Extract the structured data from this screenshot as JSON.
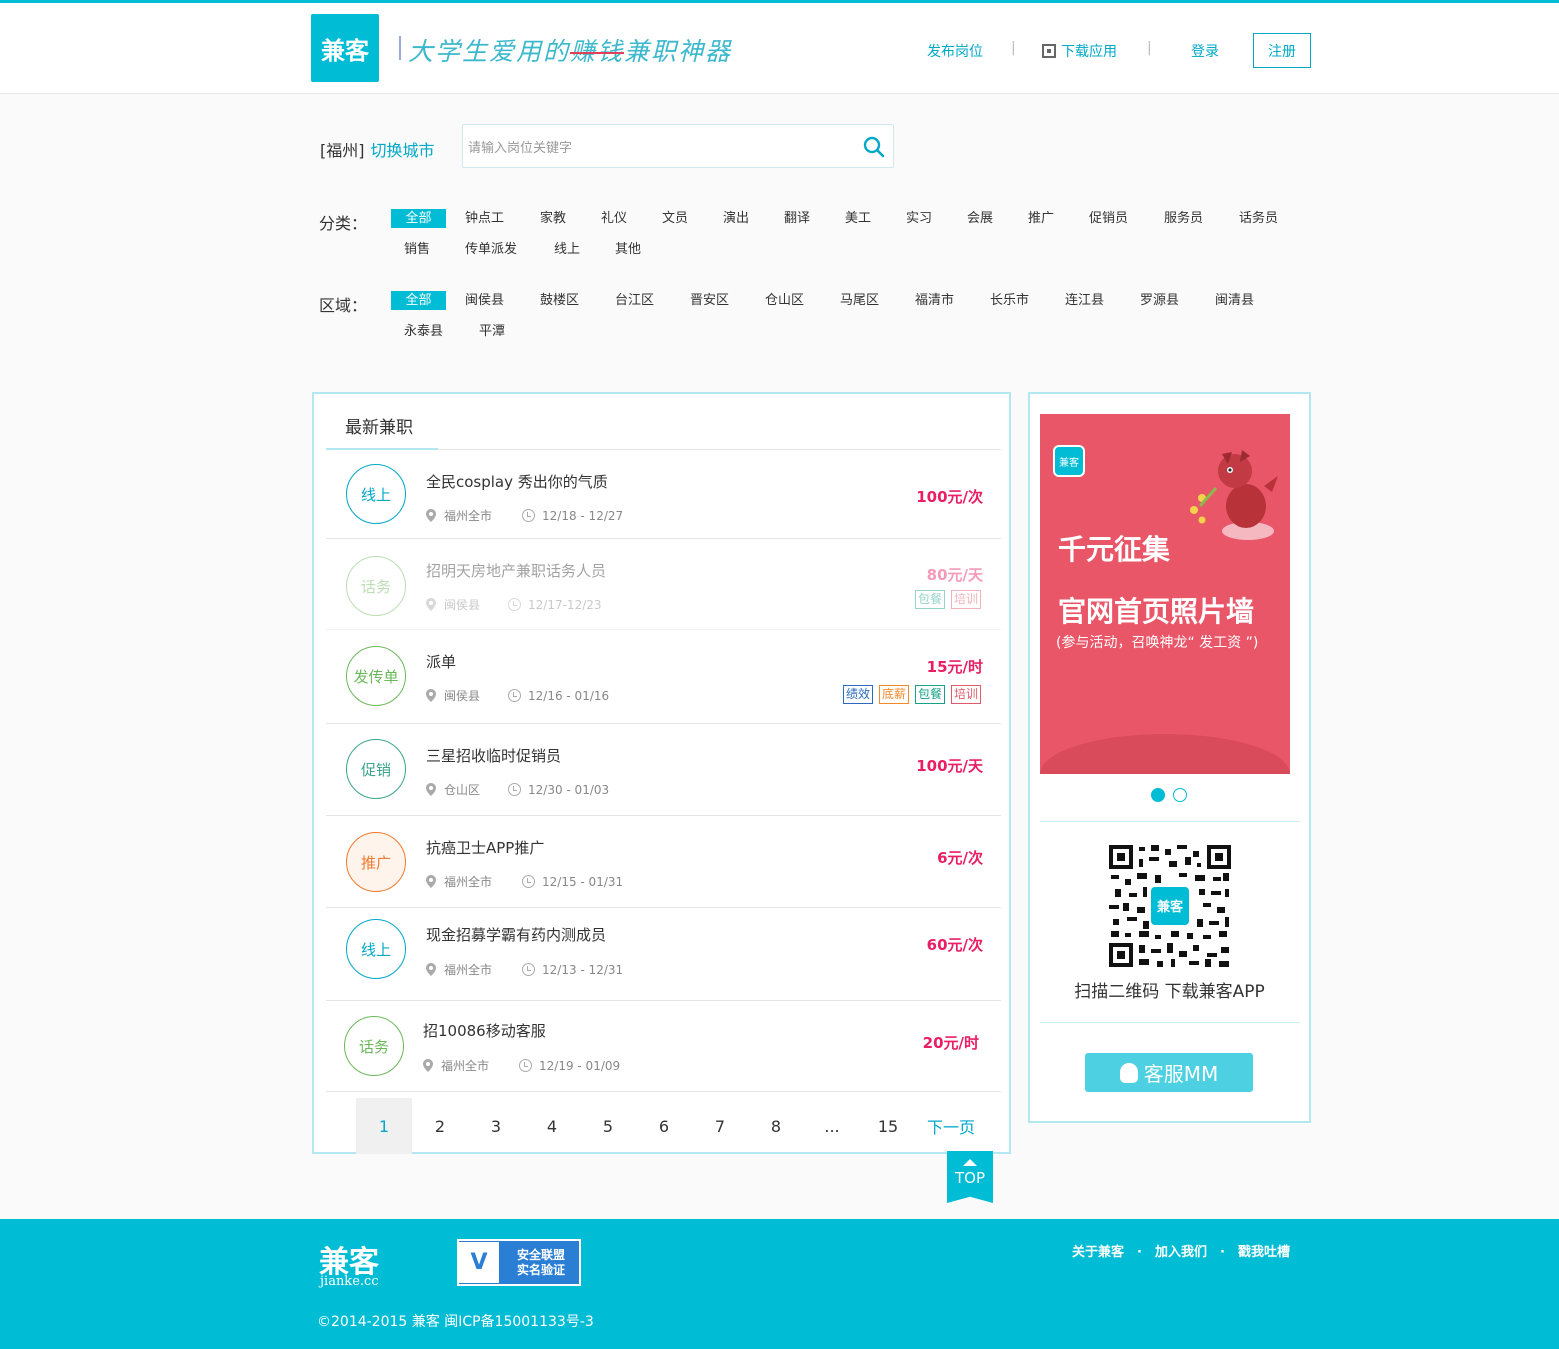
{
  "header": {
    "logo": "兼客",
    "slogan_pre": "大学生爱用的",
    "slogan_strike": "赚钱",
    "slogan_post": "兼职神器",
    "nav": {
      "post_job": "发布岗位",
      "download_app": "下载应用",
      "login": "登录",
      "register": "注册"
    }
  },
  "search": {
    "city": "[福州]",
    "switch_city": "切换城市",
    "placeholder": "请输入岗位关键字"
  },
  "filters": {
    "category_label": "分类：",
    "categories": [
      "全部",
      "钟点工",
      "家教",
      "礼仪",
      "文员",
      "演出",
      "翻译",
      "美工",
      "实习",
      "会展",
      "推广",
      "促销员",
      "服务员",
      "话务员",
      "销售",
      "传单派发",
      "线上",
      "其他"
    ],
    "region_label": "区域：",
    "regions": [
      "全部",
      "闽侯县",
      "鼓楼区",
      "台江区",
      "晋安区",
      "仓山区",
      "马尾区",
      "福清市",
      "长乐市",
      "连江县",
      "罗源县",
      "闽清县",
      "永泰县",
      "平潭"
    ]
  },
  "jobs": {
    "title": "最新兼职",
    "items": [
      {
        "badge": "线上",
        "title": "全民cosplay 秀出你的气质",
        "location": "福州全市",
        "date": "12/18 - 12/27",
        "price": "100元/次",
        "tags": []
      },
      {
        "badge": "话务",
        "title": "招明天房地产兼职话务人员",
        "location": "闽侯县",
        "date": "12/17-12/23",
        "price": "80元/天",
        "tags": [
          "包餐",
          "培训"
        ]
      },
      {
        "badge": "发传单",
        "title": "派单",
        "location": "闽侯县",
        "date": "12/16 - 01/16",
        "price": "15元/时",
        "tags": [
          "绩效",
          "底薪",
          "包餐",
          "培训"
        ]
      },
      {
        "badge": "促销",
        "title": "三星招收临时促销员",
        "location": "仓山区",
        "date": "12/30 - 01/03",
        "price": "100元/天",
        "tags": []
      },
      {
        "badge": "推广",
        "title": "抗癌卫士APP推广",
        "location": "福州全市",
        "date": "12/15 - 01/31",
        "price": "6元/次",
        "tags": []
      },
      {
        "badge": "线上",
        "title": "现金招募学霸有药内测成员",
        "location": "福州全市",
        "date": "12/13 - 12/31",
        "price": "60元/次",
        "tags": []
      },
      {
        "badge": "话务",
        "title": "招10086移动客服",
        "location": "福州全市",
        "date": "12/19 - 01/09",
        "price": "20元/时",
        "tags": []
      }
    ],
    "pager": [
      "1",
      "2",
      "3",
      "4",
      "5",
      "6",
      "7",
      "8",
      "...",
      "15"
    ],
    "next": "下一页"
  },
  "side": {
    "banner_logo": "兼客",
    "banner_h1": "千元征集",
    "banner_h2": "官网首页照片墙",
    "banner_sub": "(参与活动，召唤神龙“ 发工资 ”)",
    "qr_logo": "兼客",
    "qr_text": "扫描二维码  下载兼客APP",
    "service": "客服MM"
  },
  "totop": "TOP",
  "footer": {
    "logo": "兼客",
    "logo_sub": "jianke.cc",
    "badge_line1": "安全联盟",
    "badge_line2": "实名验证",
    "links": [
      "关于兼客",
      "加入我们",
      "戳我吐槽"
    ],
    "link_sep": "·",
    "copyright": "©2014-2015 兼客 闽ICP备15001133号-3"
  },
  "colors": {
    "accent": "#00bcd4",
    "price": "#e91e63",
    "banner": "#e85668"
  }
}
